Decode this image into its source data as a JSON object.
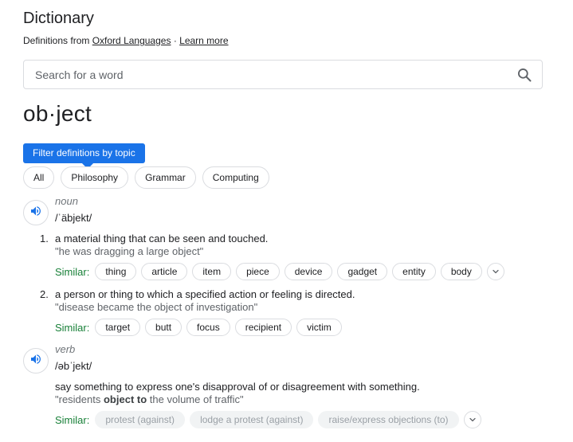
{
  "header": {
    "title": "Dictionary",
    "source_prefix": "Definitions from",
    "source_link": "Oxford Languages",
    "separator": "·",
    "learn_more": "Learn more"
  },
  "search": {
    "placeholder": "Search for a word",
    "value": "",
    "icon": "search-icon"
  },
  "word": "ob·ject",
  "filter": {
    "tooltip": "Filter definitions by topic",
    "topics": [
      "All",
      "Philosophy",
      "Grammar",
      "Computing"
    ]
  },
  "entries": [
    {
      "part_of_speech": "noun",
      "phonetic": "/ˈäbjekt/",
      "senses": [
        {
          "number": "1.",
          "definition": "a material thing that can be seen and touched.",
          "example": "\"he was dragging a large object\"",
          "similar_label": "Similar:",
          "similar": [
            "thing",
            "article",
            "item",
            "piece",
            "device",
            "gadget",
            "entity",
            "body"
          ]
        },
        {
          "number": "2.",
          "definition": "a person or thing to which a specified action or feeling is directed.",
          "example": "\"disease became the object of investigation\"",
          "similar_label": "Similar:",
          "similar": [
            "target",
            "butt",
            "focus",
            "recipient",
            "victim"
          ]
        }
      ]
    },
    {
      "part_of_speech": "verb",
      "phonetic": "/əbˈjekt/",
      "senses": [
        {
          "definition": "say something to express one's disapproval of or disagreement with something.",
          "example_pre": "\"residents ",
          "example_bold": "object to",
          "example_post": " the volume of traffic\"",
          "similar_label": "Similar:",
          "similar": [
            "protest (against)",
            "lodge a protest (against)",
            "raise/express objections (to)"
          ]
        }
      ]
    }
  ],
  "colors": {
    "accent": "#1a73e8",
    "similar_label": "#188038",
    "border": "#dadce0"
  }
}
